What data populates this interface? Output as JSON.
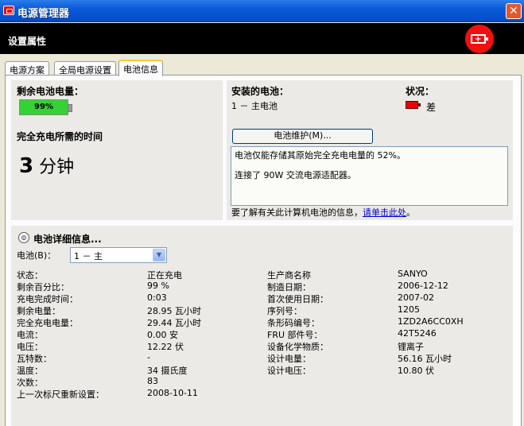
{
  "window": {
    "title": "电源管理器",
    "close_glyph": "✕"
  },
  "header": {
    "title": "设置属性",
    "logo_icon": "battery-plus-icon",
    "logo_plus": "+"
  },
  "tabs": [
    {
      "label": "电源方案"
    },
    {
      "label": "全局电源设置"
    },
    {
      "label": "电池信息",
      "active": true
    }
  ],
  "summary": {
    "remaining_label": "剩余电池电量：",
    "remaining_value": "99%",
    "remaining_fraction": 0.99,
    "full_charge_label": "完全充电所需的时间",
    "full_charge_number": "3",
    "full_charge_unit": "分钟"
  },
  "installed": {
    "label": "安装的电池：",
    "battery_line": "1 － 主电池",
    "status_label": "状况：",
    "status_value": "差",
    "maintenance_button": "电池维护(M)...",
    "messages": [
      "电池仅能存储其原始完全充电电量的 52%。",
      "连接了 90W 交流电源适配器。"
    ],
    "more_info_text": "要了解有关此计算机电池的信息，",
    "more_info_link": "请单击此处",
    "more_info_end": "。"
  },
  "details": {
    "title": "电池详细信息...",
    "expand_glyph": "◎",
    "battery_select_label": "电池(B)：",
    "battery_select_value": "1 － 主",
    "left": [
      {
        "label": "状态：",
        "value": "正在充电"
      },
      {
        "label": "剩余百分比：",
        "value": "99 %"
      },
      {
        "label": "充电完成时间：",
        "value": "0:03"
      },
      {
        "label": "剩余电量：",
        "value": "28.95 瓦小时"
      },
      {
        "label": "完全充电电量：",
        "value": "29.44 瓦小时"
      },
      {
        "label": "电流：",
        "value": "0.00 安"
      },
      {
        "label": "电压：",
        "value": "12.22 伏"
      },
      {
        "label": "瓦特数：",
        "value": "-"
      },
      {
        "label": "温度：",
        "value": "34 摄氏度"
      },
      {
        "label": "次数：",
        "value": "83"
      },
      {
        "label": "上一次标尺重新设置：",
        "value": "2008-10-11"
      }
    ],
    "right": [
      {
        "label": "生产商名称",
        "value": "SANYO"
      },
      {
        "label": "制造日期：",
        "value": "2006-12-12"
      },
      {
        "label": "首次使用日期：",
        "value": "2007-02"
      },
      {
        "label": "序列号：",
        "value": "1205"
      },
      {
        "label": "条形码编号：",
        "value": "1ZD2A6CC0XH"
      },
      {
        "label": "FRU 部件号：",
        "value": "42T5246"
      },
      {
        "label": "设备化学物质：",
        "value": "锂离子"
      },
      {
        "label": "设计电量：",
        "value": "56.16 瓦小时"
      },
      {
        "label": "设计电压：",
        "value": "10.80 伏"
      }
    ]
  },
  "colors": {
    "title_bar": "#0a5ad8",
    "battery_fill": "#35d235",
    "status_bad": "#e00000",
    "logo": "#f01010"
  }
}
